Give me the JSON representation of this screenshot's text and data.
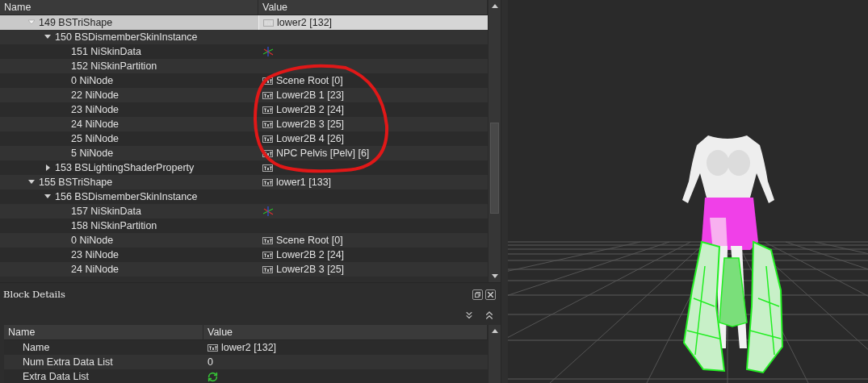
{
  "tree": {
    "columns": [
      "Name",
      "Value"
    ],
    "nodes": [
      {
        "name": "149 BSTriShape",
        "value": "lower2 [132]",
        "kind": "text",
        "expanded": true,
        "selected": true,
        "children": [
          {
            "name": "150 BSDismemberSkinInstance",
            "kind": "plain",
            "expanded": true,
            "selected": false,
            "children": [
              {
                "name": "151 NiSkinData",
                "kind": "axes",
                "selected": false
              },
              {
                "name": "152 NiSkinPartition",
                "kind": "plain",
                "selected": false
              },
              {
                "name": "0 NiNode",
                "value": "Scene Root [0]",
                "kind": "text",
                "selected": false
              },
              {
                "name": "22 NiNode",
                "value": "Lower2B 1 [23]",
                "kind": "text",
                "selected": false
              },
              {
                "name": "23 NiNode",
                "value": "Lower2B 2 [24]",
                "kind": "text",
                "selected": false
              },
              {
                "name": "24 NiNode",
                "value": "Lower2B 3 [25]",
                "kind": "text",
                "selected": false
              },
              {
                "name": "25 NiNode",
                "value": "Lower2B 4 [26]",
                "kind": "text",
                "selected": false
              },
              {
                "name": "5 NiNode",
                "value": "NPC Pelvis [Pelv] [6]",
                "kind": "text",
                "selected": false
              }
            ]
          },
          {
            "name": "153 BSLightingShaderProperty",
            "kind": "text",
            "expanded": false,
            "selected": false
          }
        ]
      },
      {
        "name": "155 BSTriShape",
        "value": "lower1 [133]",
        "kind": "text",
        "expanded": true,
        "selected": false,
        "children": [
          {
            "name": "156 BSDismemberSkinInstance",
            "kind": "plain",
            "expanded": true,
            "selected": false,
            "children": [
              {
                "name": "157 NiSkinData",
                "kind": "axes",
                "selected": false
              },
              {
                "name": "158 NiSkinPartition",
                "kind": "plain",
                "selected": false
              },
              {
                "name": "0 NiNode",
                "value": "Scene Root [0]",
                "kind": "text",
                "selected": false
              },
              {
                "name": "23 NiNode",
                "value": "Lower2B 2 [24]",
                "kind": "text",
                "selected": false
              },
              {
                "name": "24 NiNode",
                "value": "Lower2B 3 [25]",
                "kind": "text",
                "selected": false
              }
            ]
          }
        ]
      }
    ]
  },
  "details": {
    "title": "Block Details",
    "columns": [
      "Name",
      "Value"
    ],
    "rows": [
      {
        "name": "Name",
        "value": "lower2 [132]",
        "kind": "text"
      },
      {
        "name": "Num Extra Data List",
        "value": "0",
        "kind": "plain"
      },
      {
        "name": "Extra Data List",
        "kind": "refresh"
      }
    ]
  }
}
